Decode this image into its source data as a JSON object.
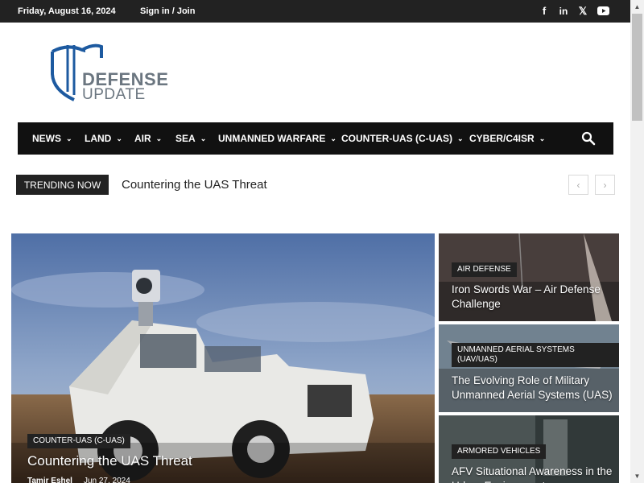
{
  "topbar": {
    "date": "Friday, August 16, 2024",
    "signin": "Sign in / Join",
    "social": [
      {
        "icon": "facebook-icon",
        "glyph": "f"
      },
      {
        "icon": "linkedin-icon",
        "glyph": "in"
      },
      {
        "icon": "x-icon",
        "glyph": "𝕏"
      },
      {
        "icon": "youtube-icon",
        "glyph": "▶"
      }
    ]
  },
  "logo": {
    "line1": "DEFENSE",
    "line2": "UPDATE",
    "color": "#1d5aa0"
  },
  "nav": {
    "items": [
      {
        "label": "NEWS"
      },
      {
        "label": "LAND"
      },
      {
        "label": "AIR"
      },
      {
        "label": "SEA"
      },
      {
        "label": "UNMANNED WARFARE"
      },
      {
        "label": "COUNTER-UAS (C-UAS)"
      },
      {
        "label": "CYBER/C4ISR"
      }
    ]
  },
  "trending": {
    "label": "TRENDING NOW",
    "headline": "Countering the UAS Threat",
    "prev": "‹",
    "next": "›"
  },
  "feature": {
    "category": "COUNTER-UAS (C-UAS)",
    "title": "Countering the UAS Threat",
    "author": "Tamir Eshel",
    "date": "Jun 27, 2024"
  },
  "side_cards": [
    {
      "category": "AIR DEFENSE",
      "title": "Iron Swords War – Air Defense Challenge"
    },
    {
      "category": "UNMANNED AERIAL SYSTEMS (UAV/UAS)",
      "title": "The Evolving Role of Military Unmanned Aerial Systems (UAS)"
    },
    {
      "category": "ARMORED VEHICLES",
      "title": "AFV Situational Awareness in the Urban Environment"
    }
  ]
}
